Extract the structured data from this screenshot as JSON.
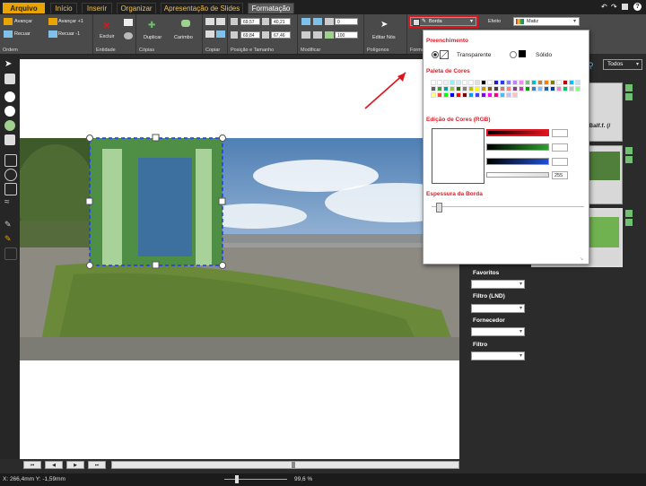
{
  "tabs": [
    {
      "label": "Arquivo",
      "kind": "file"
    },
    {
      "label": "Início",
      "kind": "normal"
    },
    {
      "label": "Inserir",
      "kind": "normal"
    },
    {
      "label": "Organizar",
      "kind": "normal"
    },
    {
      "label": "Apresentação de Slides",
      "kind": "normal"
    },
    {
      "label": "Formatação",
      "kind": "active"
    }
  ],
  "ribbon": {
    "order": {
      "advance": "Avançar",
      "advance_one": "Avançar +1",
      "back": "Recuar",
      "back_one": "Recuar -1",
      "label": "Ordem"
    },
    "entity": {
      "delete": "Excluir",
      "label": "Entidade"
    },
    "copies": {
      "duplicate": "Duplicar",
      "stamp": "Carimbo",
      "label": "Cópias"
    },
    "copy": {
      "label": "Copiar"
    },
    "position": {
      "x": "69,57",
      "w": "40,21",
      "y": "69,84",
      "h": "67,46",
      "label": "Posição e Tamanho"
    },
    "modify": {
      "angle": "0",
      "percent": "100",
      "label": "Modificar"
    },
    "polygons": {
      "edit_nodes": "Editar Nós",
      "label": "Polígonos"
    },
    "format": {
      "label": "Format",
      "border_dropdown": "Borda",
      "effect_label": "Efeito",
      "effect_value": "Matiz"
    }
  },
  "popup": {
    "fill_title": "Preenchimento",
    "fill_transparent": "Transparente",
    "fill_solid": "Sólido",
    "palette_title": "Paleta de Cores",
    "rgb_title": "Edição de Cores (RGB)",
    "alpha_value": "255",
    "border_thickness_title": "Espessura da Borda",
    "palette": [
      "#ffffff",
      "#ffffff",
      "#f0f0f0",
      "#8ff0ff",
      "#c0f0ff",
      "#ffffff",
      "#ffffff",
      "#e0e0e0",
      "#000000",
      "#ffffff",
      "#2020c0",
      "#2040ff",
      "#8080ff",
      "#c080ff",
      "#ff80ff",
      "#80c080",
      "#00c0c0",
      "#c08040",
      "#ff8000",
      "#808000",
      "#ffffff",
      "#c00000",
      "#00c0ff",
      "#c0e0ff",
      "#606060",
      "#40a040",
      "#00a0a0",
      "#a0c040",
      "#406020",
      "#808080",
      "#c0c000",
      "#ffff00",
      "#c0a000",
      "#806020",
      "#404040",
      "#c08080",
      "#ff8080",
      "#804080",
      "#c040c0",
      "#00a000",
      "#4080c0",
      "#80c0ff",
      "#2060a0",
      "#0040a0",
      "#ff80c0",
      "#00c060",
      "#c0c0c0",
      "#80ff80",
      "#ffff80",
      "#ff4040",
      "#00ff00",
      "#0000ff",
      "#ff0000",
      "#800000",
      "#00a0ff",
      "#4040ff",
      "#8000ff",
      "#ff00ff",
      "#ff0080",
      "#40c0ff",
      "#c0c0ff",
      "#ffc0c0"
    ]
  },
  "right_pane": {
    "filter_all": "Todos",
    "clip_caption": "e Balf.f. (/",
    "favorites": "Favoritos",
    "filter_lnd": "Filtro (LND)",
    "supplier": "Fornecedor",
    "filter": "Filtro"
  },
  "status": {
    "coords": "X: 266,4mm Y: -1,59mm",
    "zoom": "99,6 %"
  },
  "colors": {
    "accent": "#e9a400",
    "highlight_red": "#e0141e",
    "dashed_selection": "#1a3cff"
  }
}
